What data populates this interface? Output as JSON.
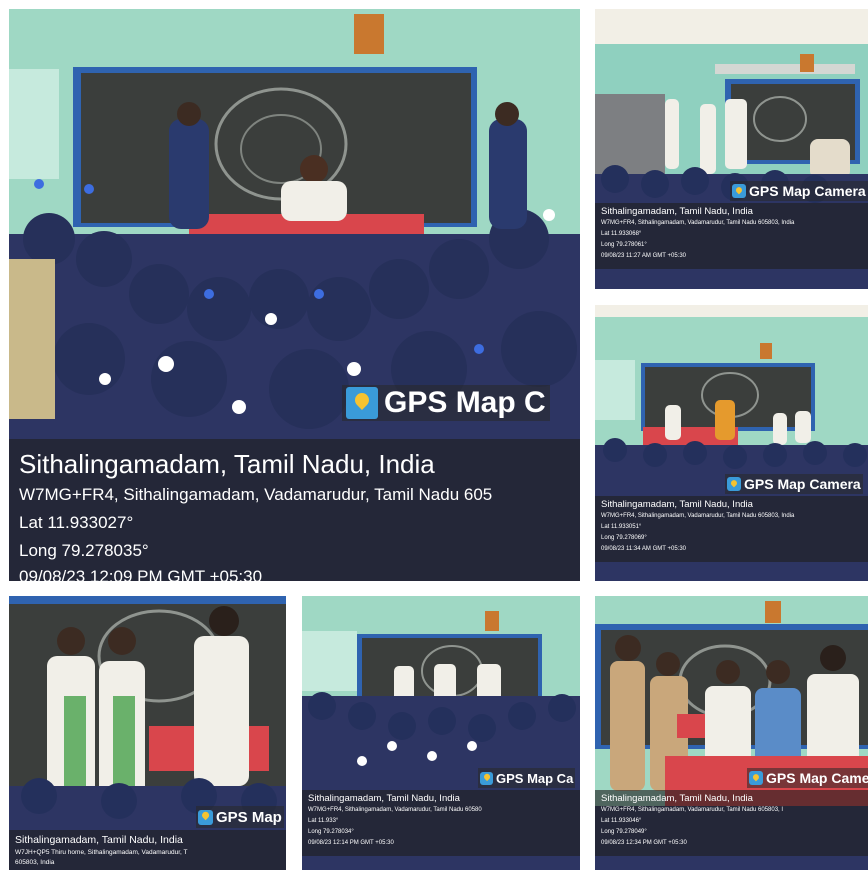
{
  "photos": [
    {
      "id": "main",
      "badge": "GPS Map C",
      "place": "Sithalingamadam, Tamil Nadu, India",
      "address": "W7MG+FR4, Sithalingamadam, Vadamarudur, Tamil Nadu 605",
      "lat": "Lat 11.933027°",
      "long": "Long 79.278035°",
      "time": "09/08/23 12:09 PM GMT +05:30"
    },
    {
      "id": "top-right",
      "badge": "GPS Map Camera",
      "place": "Sithalingamadam, Tamil Nadu, India",
      "address": "W7MG+FR4, Sithalingamadam, Vadamarudur, Tamil Nadu 605803, India",
      "lat": "Lat 11.933068°",
      "long": "Long 79.278061°",
      "time": "09/08/23 11:27 AM GMT +05:30"
    },
    {
      "id": "mid-right",
      "badge": "GPS Map Camera",
      "place": "Sithalingamadam, Tamil Nadu, India",
      "address": "W7MG+FR4, Sithalingamadam, Vadamarudur, Tamil Nadu 605803, India",
      "lat": "Lat 11.933051°",
      "long": "Long 79.278069°",
      "time": "09/08/23 11:34 AM GMT +05:30"
    },
    {
      "id": "bottom-left",
      "badge": "GPS Map",
      "place": "Sithalingamadam, Tamil Nadu, India",
      "address": "W7JH+QP5 Thiru home, Sithalingamadam, Vadamarudur, T",
      "address2": "605803, India"
    },
    {
      "id": "bottom-mid",
      "badge": "GPS Map Ca",
      "place": "Sithalingamadam, Tamil Nadu, India",
      "address": "W7MG+FR4, Sithalingamadam, Vadamarudur, Tamil Nadu 60580",
      "lat": "Lat 11.933°",
      "long": "Long 79.278034°",
      "time": "09/08/23 12:14 PM GMT +05:30"
    },
    {
      "id": "bottom-right",
      "badge": "GPS Map Came",
      "place": "Sithalingamadam, Tamil Nadu, India",
      "address": "W7MG+FR4, Sithalingamadam, Vadamarudur, Tamil Nadu 605803, I",
      "lat": "Lat 11.933046°",
      "long": "Long 79.278049°",
      "time": "09/08/23 12:34 PM GMT +05:30"
    }
  ],
  "colors": {
    "wall": "#9fd8c4",
    "board": "#3b3e3c",
    "board_frame": "#2f63b0",
    "tablecloth": "#d9464c",
    "uniform": "#273564",
    "overlay_pin": "#3a9bd9"
  }
}
